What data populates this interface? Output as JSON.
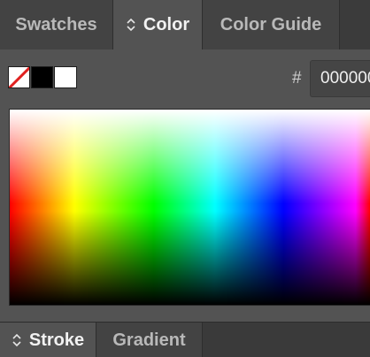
{
  "tabs": [
    {
      "label": "Swatches",
      "active": false
    },
    {
      "label": "Color",
      "active": true
    },
    {
      "label": "Color Guide",
      "active": false
    }
  ],
  "color": {
    "swatches": [
      {
        "name": "none",
        "color": "#ffffff"
      },
      {
        "name": "black",
        "color": "#000000"
      },
      {
        "name": "white",
        "color": "#ffffff"
      }
    ],
    "hash_label": "#",
    "hex_value": "000000"
  },
  "bottom_tabs": [
    {
      "label": "Stroke",
      "active": true
    },
    {
      "label": "Gradient",
      "active": false
    }
  ],
  "colors": {
    "panel_bg": "#535353",
    "tab_inactive_bg": "#434343",
    "tab_bar_bg": "#3a3a3a",
    "none_slash": "#e0201f"
  }
}
